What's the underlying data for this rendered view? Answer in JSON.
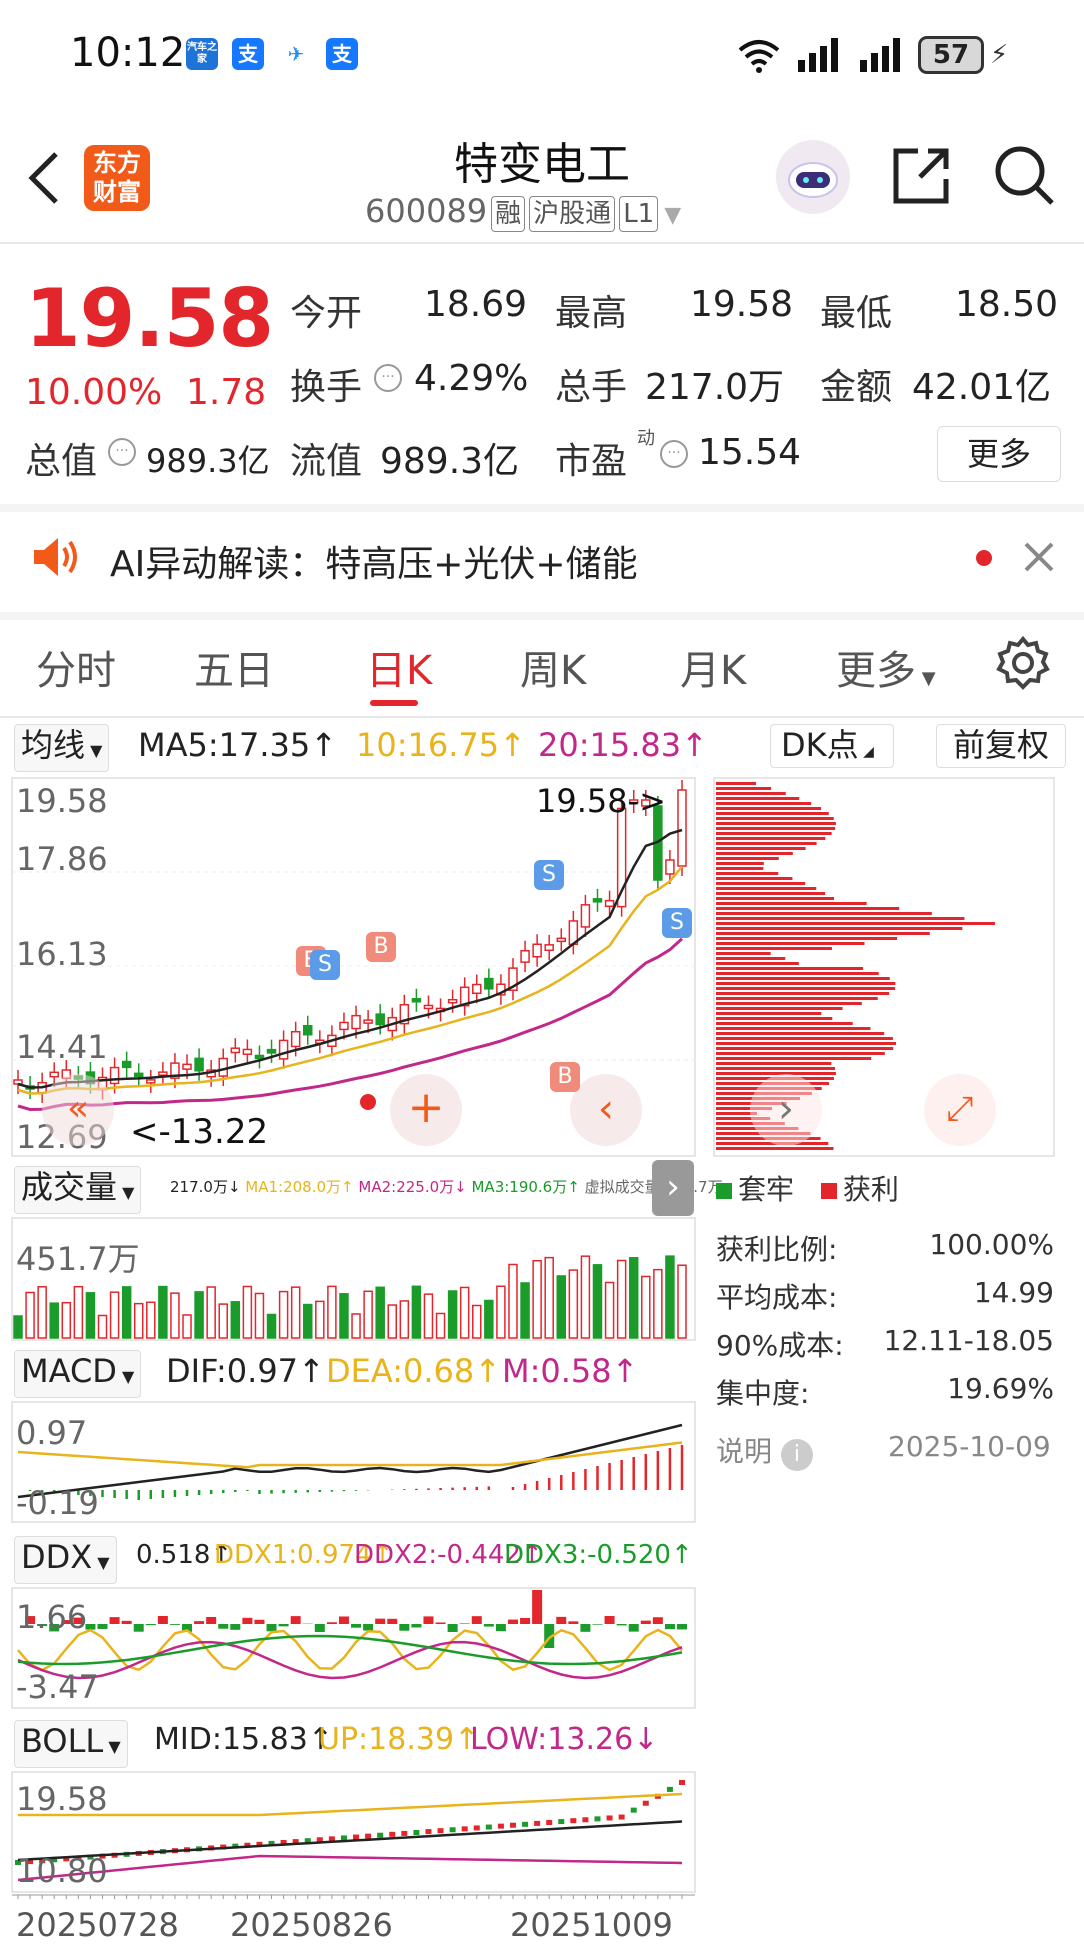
{
  "status_bar": {
    "time": "10:12",
    "battery": "57"
  },
  "header": {
    "title": "特变电工",
    "code": "600089",
    "tag_margin": "融",
    "tag_connect": "沪股通",
    "tag_level": "L1",
    "logo_line1": "东方",
    "logo_line2": "财富"
  },
  "quote": {
    "price": "19.58",
    "change_pct": "10.00%",
    "change_amt": "1.78",
    "open_label": "今开",
    "open": "18.69",
    "high_label": "最高",
    "high": "19.58",
    "low_label": "最低",
    "low": "18.50",
    "turnover_label": "换手",
    "turnover": "4.29%",
    "volume_label": "总手",
    "volume": "217.0万",
    "amount_label": "金额",
    "amount": "42.01亿",
    "mktcap_label": "总值",
    "mktcap": "989.3亿",
    "float_label": "流值",
    "float": "989.3亿",
    "pe_label": "市盈",
    "pe_sup": "动",
    "pe": "15.54",
    "more_label": "更多"
  },
  "ai": {
    "text": "AI异动解读：特高压+光伏+储能"
  },
  "tabs": [
    "分时",
    "五日",
    "日K",
    "周K",
    "月K",
    "更多"
  ],
  "ma_bar": {
    "selector": "均线",
    "ma5": "MA5:17.35↑",
    "ma10": "10:16.75↑",
    "ma20": "20:15.83↑",
    "dk": "DK点",
    "fq": "前复权"
  },
  "kline": {
    "y_labels": [
      "19.58",
      "17.86",
      "16.13",
      "14.41",
      "12.69"
    ],
    "price_arrow": "19.58->",
    "low_marker": "<-13.22"
  },
  "volume": {
    "selector": "成交量",
    "legend": "217.0万↓",
    "ma1": "MA1:208.0万↑",
    "ma2": "MA2:225.0万↓",
    "ma3": "MA3:190.6万↑",
    "virtual": "虚拟成交量:451.7万",
    "y_top": "451.7万"
  },
  "macd": {
    "selector": "MACD",
    "dif": "DIF:0.97↑",
    "dea": "DEA:0.68↑",
    "m": "M:0.58↑",
    "y_top": "0.97",
    "y_bottom": "-0.19"
  },
  "ddx": {
    "selector": "DDX",
    "v": "0.518↑",
    "ddx1": "DDX1:0.974↑",
    "ddx2": "DDX2:-0.442↑",
    "ddx3": "DDX3:-0.520↑",
    "y_top": "1.66",
    "y_bottom": "-3.47"
  },
  "boll": {
    "selector": "BOLL",
    "mid": "MID:15.83↑",
    "up": "UP:18.39↑",
    "low": "LOW:13.26↓",
    "y_top": "19.58",
    "y_bottom": "10.80"
  },
  "dates": [
    "20250728",
    "20250826",
    "20251009"
  ],
  "chip": {
    "legend_trapped": "套牢",
    "legend_profit": "获利",
    "rows": [
      {
        "label": "获利比例:",
        "value": "100.00%"
      },
      {
        "label": "平均成本:",
        "value": "14.99"
      },
      {
        "label": "90%成本:",
        "value": "12.11-18.05"
      },
      {
        "label": "集中度:",
        "value": "19.69%"
      }
    ],
    "note_label": "说明",
    "date": "2025-10-09"
  },
  "colors": {
    "up": "#e3262b",
    "down": "#1a9b2a",
    "ma5": "#222222",
    "ma10": "#e8b31b",
    "ma20": "#c2278a"
  }
}
